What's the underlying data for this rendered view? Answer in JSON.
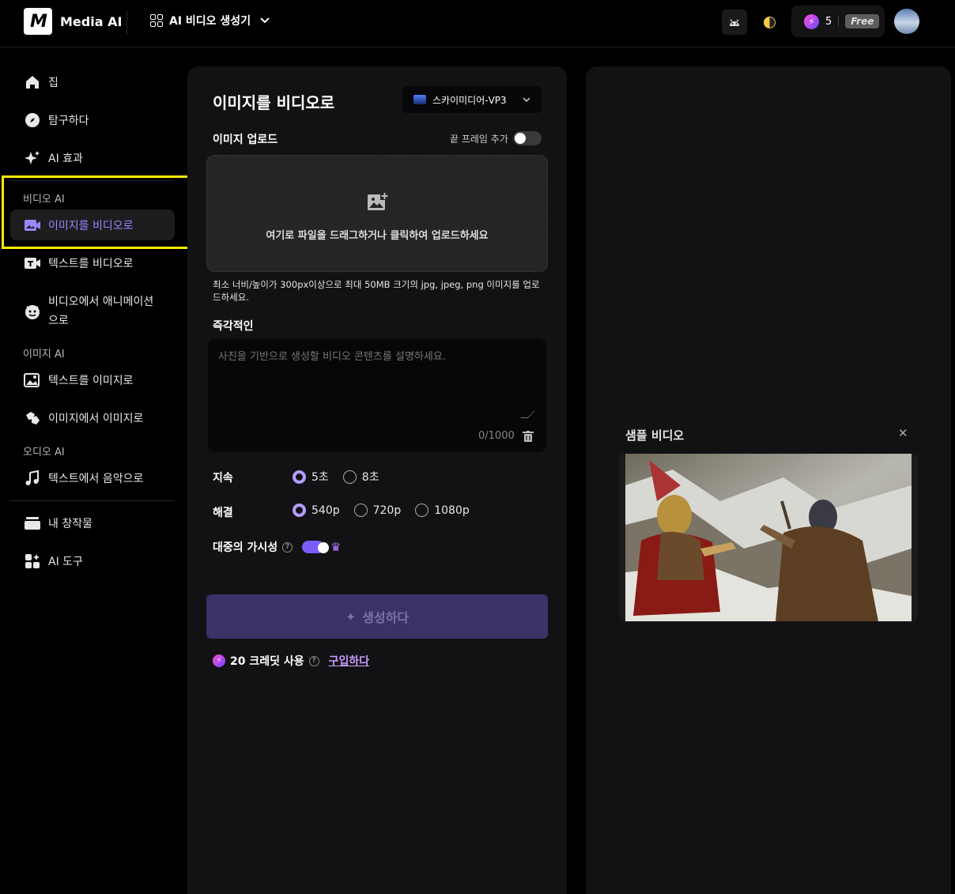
{
  "header": {
    "logo_mark": "M",
    "brand": "Media AI",
    "tool_selector": "AI 비디오 생성기",
    "credits": "5",
    "plan_badge": "Free"
  },
  "sidebar": {
    "top_items": [
      {
        "label": "집",
        "icon": "home-icon"
      },
      {
        "label": "탐구하다",
        "icon": "compass-icon"
      },
      {
        "label": "AI 효과",
        "icon": "sparkle-icon"
      }
    ],
    "video_section": "비디오 AI",
    "video_items": [
      {
        "label": "이미지를 비디오로",
        "icon": "image-video-icon",
        "active": true
      },
      {
        "label": "텍스트를 비디오로",
        "icon": "text-video-icon"
      },
      {
        "label": "비디오에서 애니메이션으로",
        "icon": "animation-icon"
      }
    ],
    "image_section": "이미지 AI",
    "image_items": [
      {
        "label": "텍스트를 이미지로",
        "icon": "text-image-icon"
      },
      {
        "label": "이미지에서 이미지로",
        "icon": "image-image-icon"
      }
    ],
    "audio_section": "오디오 AI",
    "audio_items": [
      {
        "label": "텍스트에서 음악으로",
        "icon": "music-icon"
      }
    ],
    "bottom_items": [
      {
        "label": "내 창작물",
        "icon": "creations-icon"
      },
      {
        "label": "AI 도구",
        "icon": "tools-icon"
      }
    ]
  },
  "form": {
    "title": "이미지를 비디오로",
    "model": "스카이미디어-VP3",
    "upload_label": "이미지 업로드",
    "end_frame_label": "끝 프레임 추가",
    "end_frame_on": false,
    "upload_text": "여기로 파일을 드래그하거나 클릭하여 업로드하세요",
    "hint": "최소 너비/높이가 300px이상으로 최대 50MB 크기의 jpg, jpeg, png 이미지를 업로드하세요.",
    "prompt_label": "즉각적인",
    "prompt_placeholder": "사진을 기반으로 생성할 비디오 콘텐츠를 설명하세요.",
    "prompt_counter": "0/1000",
    "duration_label": "지속",
    "duration_options": [
      "5초",
      "8초"
    ],
    "duration_selected": "5초",
    "resolution_label": "해결",
    "resolution_options": [
      "540p",
      "720p",
      "1080p"
    ],
    "resolution_selected": "540p",
    "visibility_label": "대중의 가시성",
    "visibility_on": true,
    "generate_label": "생성하다",
    "credit_use": "20 크레딧 사용",
    "buy_label": "구입하다"
  },
  "sample": {
    "title": "샘플 비디오"
  },
  "colors": {
    "accent": "#7a5cff",
    "highlight": "#ffea00",
    "generate_bg": "#3b3368"
  }
}
